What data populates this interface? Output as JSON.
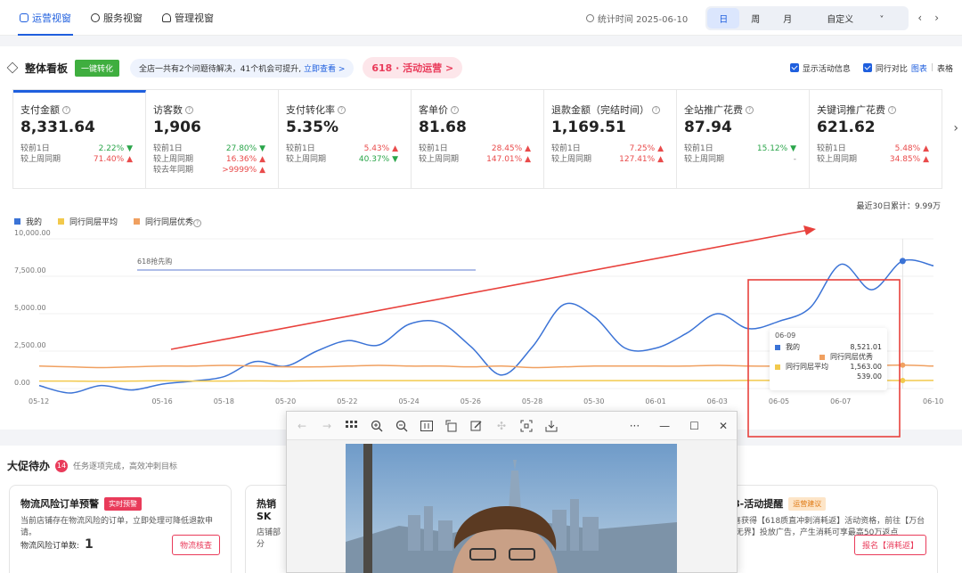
{
  "topnav": {
    "tabs": [
      {
        "label": "运营视窗",
        "active": true
      },
      {
        "label": "服务视窗",
        "active": false
      },
      {
        "label": "管理视窗",
        "active": false
      }
    ],
    "stat_time": "统计时间 2025-06-10",
    "periods": [
      "日",
      "周",
      "月",
      "自定义"
    ],
    "selected_period": "日"
  },
  "panel": {
    "title": "整体看板",
    "one_click_btn": "一键转化",
    "tip_text": "全店一共有2个问题待解决，41个机会可提升,",
    "tip_link": "立即查看 >",
    "promo": "618 · 活动运营 >",
    "opt_show_activity": "显示活动信息",
    "opt_peer_compare": "同行对比",
    "view_chart": "图表",
    "view_sep": "|",
    "view_table": "表格"
  },
  "metrics": [
    {
      "label": "支付金额",
      "value": "8,331.64",
      "rows": [
        {
          "k": "较前1日",
          "v": "2.22%",
          "dir": "down"
        },
        {
          "k": "较上周同期",
          "v": "71.40%",
          "dir": "up"
        }
      ]
    },
    {
      "label": "访客数",
      "value": "1,906",
      "rows": [
        {
          "k": "较前1日",
          "v": "27.80%",
          "dir": "down"
        },
        {
          "k": "较上周同期",
          "v": "16.36%",
          "dir": "up"
        },
        {
          "k": "较去年同期",
          "v": ">9999%",
          "dir": "up"
        }
      ]
    },
    {
      "label": "支付转化率",
      "value": "5.35%",
      "rows": [
        {
          "k": "较前1日",
          "v": "5.43%",
          "dir": "up"
        },
        {
          "k": "较上周同期",
          "v": "40.37%",
          "dir": "down"
        }
      ]
    },
    {
      "label": "客单价",
      "value": "81.68",
      "rows": [
        {
          "k": "较前1日",
          "v": "28.45%",
          "dir": "up"
        },
        {
          "k": "较上周同期",
          "v": "147.01%",
          "dir": "up"
        }
      ]
    },
    {
      "label": "退款金额（完结时间）",
      "value": "1,169.51",
      "rows": [
        {
          "k": "较前1日",
          "v": "7.25%",
          "dir": "up"
        },
        {
          "k": "较上周同期",
          "v": "127.41%",
          "dir": "up"
        }
      ]
    },
    {
      "label": "全站推广花费",
      "value": "87.94",
      "rows": [
        {
          "k": "较前1日",
          "v": "15.12%",
          "dir": "down"
        },
        {
          "k": "较上周同期",
          "v": "-",
          "dir": "none"
        }
      ]
    },
    {
      "label": "关键词推广花费",
      "value": "621.62",
      "rows": [
        {
          "k": "较前1日",
          "v": "5.48%",
          "dir": "up"
        },
        {
          "k": "较上周同期",
          "v": "34.85%",
          "dir": "up"
        }
      ]
    }
  ],
  "chart_legend": [
    "我的",
    "同行同层平均",
    "同行同层优秀"
  ],
  "chart_cum": "最近30日累计：9.99万",
  "chart_annotation": "618抢先购",
  "tooltip": {
    "date": "06-09",
    "rows": [
      {
        "name": "我的",
        "value": "8,521.01"
      },
      {
        "name": "同行同层优秀",
        "value": ""
      },
      {
        "name": "同行同层平均",
        "value": "1,563.00"
      },
      {
        "name": "",
        "value": "539.00"
      }
    ]
  },
  "chart_data": {
    "type": "line",
    "x": [
      "05-12",
      "05-13",
      "05-14",
      "05-15",
      "05-16",
      "05-17",
      "05-18",
      "05-19",
      "05-20",
      "05-21",
      "05-22",
      "05-23",
      "05-24",
      "05-25",
      "05-26",
      "05-27",
      "05-28",
      "05-29",
      "05-30",
      "05-31",
      "06-01",
      "06-02",
      "06-03",
      "06-04",
      "06-05",
      "06-06",
      "06-07",
      "06-08",
      "06-09",
      "06-10"
    ],
    "x_tick_labels": [
      "05-12",
      "05-16",
      "05-18",
      "05-20",
      "05-22",
      "05-24",
      "05-26",
      "05-28",
      "05-30",
      "06-01",
      "06-03",
      "06-05",
      "06-07",
      "06-10"
    ],
    "y_tick_labels": [
      "0.00",
      "2,500.00",
      "5,000.00",
      "7,500.00",
      "10,000.00"
    ],
    "ylim": [
      0,
      10000
    ],
    "series": [
      {
        "name": "我的",
        "color": "#3b73d6",
        "values": [
          200,
          -300,
          200,
          -100,
          300,
          500,
          800,
          1800,
          1500,
          2500,
          3200,
          2900,
          4300,
          4400,
          2800,
          900,
          2800,
          5600,
          4800,
          2700,
          2700,
          3700,
          5000,
          4000,
          4500,
          5400,
          8300,
          6600,
          8521,
          8200
        ]
      },
      {
        "name": "同行同层优秀",
        "color": "#f0a060",
        "values": [
          1500,
          1450,
          1400,
          1450,
          1500,
          1500,
          1550,
          1500,
          1450,
          1450,
          1500,
          1550,
          1500,
          1500,
          1450,
          1500,
          1400,
          1450,
          1500,
          1500,
          1500,
          1500,
          1550,
          1500,
          1500,
          1500,
          1550,
          1550,
          1563,
          1500
        ]
      },
      {
        "name": "同行同层平均",
        "color": "#f2c94c",
        "values": [
          500,
          500,
          480,
          500,
          520,
          500,
          500,
          510,
          500,
          520,
          530,
          530,
          530,
          530,
          530,
          530,
          530,
          530,
          530,
          530,
          530,
          530,
          530,
          540,
          540,
          540,
          540,
          540,
          539,
          540
        ]
      }
    ]
  },
  "todo": {
    "title": "大促待办",
    "count": "14",
    "subtitle": "任务逐项完成，高效冲刺目标",
    "cards": [
      {
        "title": "物流风险订单预警",
        "tag": "实时预警",
        "desc": "当前店铺存在物流风险的订单，立即处理可降低退款申请。",
        "foot_label": "物流风险订单数:",
        "foot_value": "1",
        "btn": "物流核查"
      },
      {
        "title": "热销SK",
        "tag": "",
        "desc": "店铺部分",
        "foot_label": "",
        "foot_value": "",
        "btn": ""
      },
      {
        "title": "8-活动提醒",
        "tag": "运营建议",
        "desc": "喜获得【618质直冲刺消耗返】活动资格，前往【万台·无界】投放广告，产生消耗可享最高50万返点",
        "foot_label": "",
        "foot_value": "",
        "btn": "报名【消耗返】"
      }
    ]
  },
  "viewer": {
    "more": "···",
    "minimize": "—",
    "maximize": "☐",
    "close": "✕"
  }
}
